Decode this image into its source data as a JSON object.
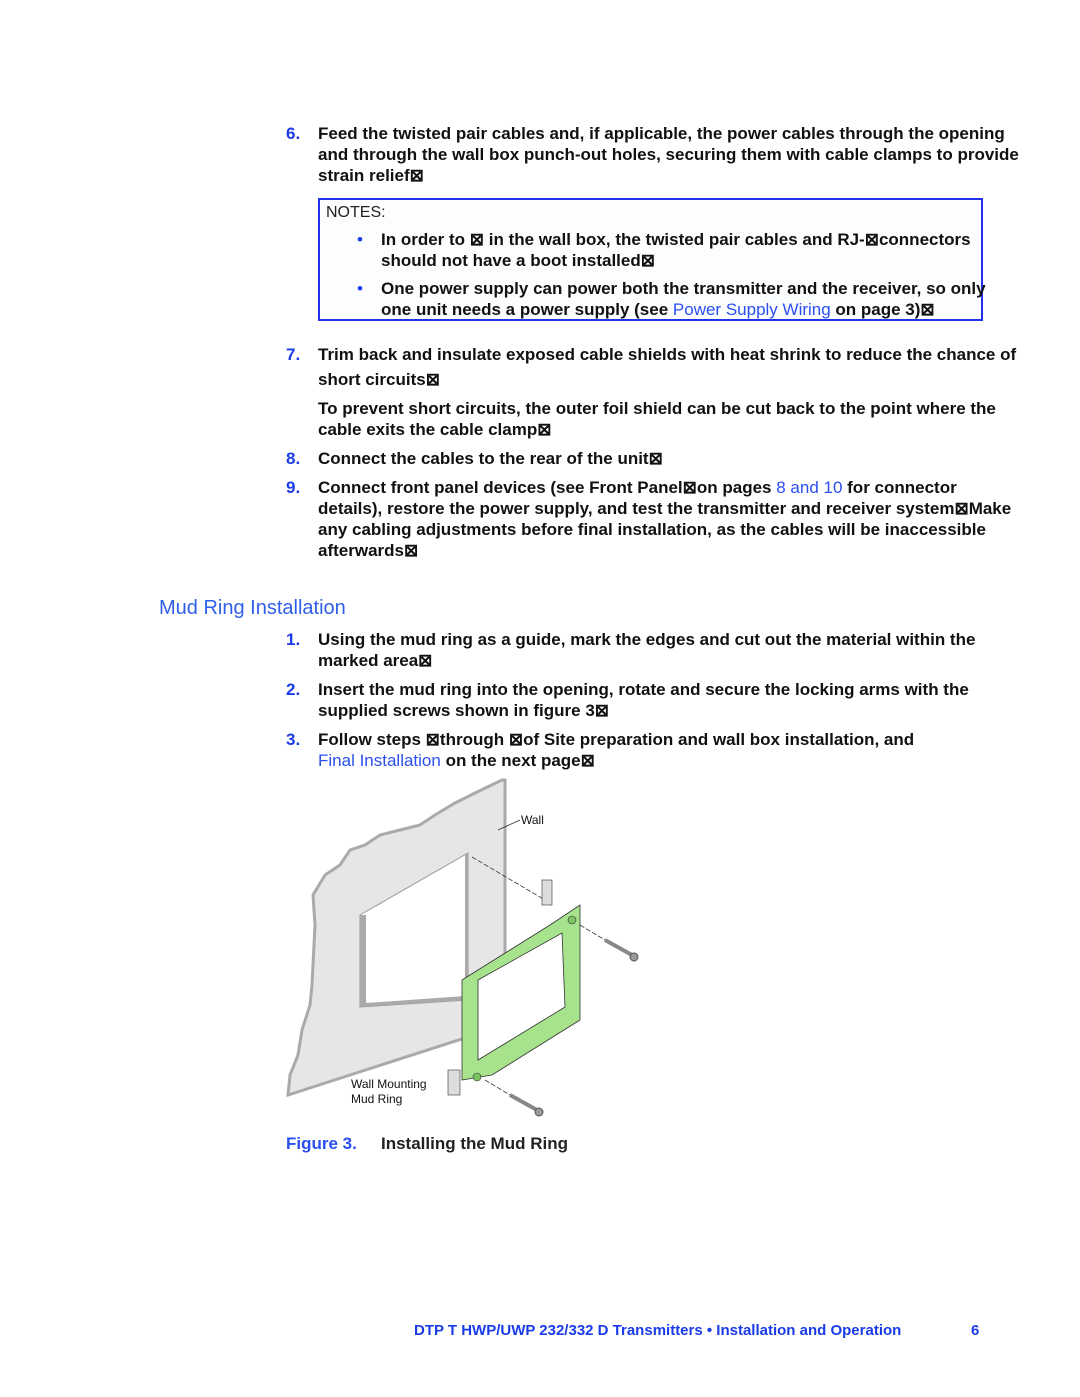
{
  "step6": {
    "num": "6.",
    "lines": [
      "Feed the twisted pair cables and, if applicable, the power cables through the opening",
      "and through the wall box punch-out holes, securing them with cable clamps to provide",
      "strain relief⊠"
    ]
  },
  "notes": {
    "title": "NOTES:",
    "bullet1": [
      "In order to ⊠ in the wall box, the twisted pair cables and RJ-⊠connectors",
      "should not have a boot installed⊠"
    ],
    "bullet2_line1": "One power supply can power both the transmitter and the receiver, so only",
    "bullet2_line2_pre": "one unit needs a power supply (see ",
    "bullet2_link": "Power Supply Wiring",
    "bullet2_line2_post": " on page 3)⊠"
  },
  "step7": {
    "num": "7.",
    "lines": [
      "Trim back and insulate exposed cable shields with heat shrink to reduce the chance of",
      "short circuits⊠"
    ],
    "para": [
      "To prevent short circuits, the outer foil shield can be cut back to the point where the",
      "cable exits the cable clamp⊠"
    ]
  },
  "step8": {
    "num": "8.",
    "text": "Connect the cables to the rear of the unit⊠"
  },
  "step9": {
    "num": "9.",
    "line1_pre": "Connect front panel devices (see Front Panel⊠on pages ",
    "line1_link": "8 and 10",
    "line1_post": " for connector",
    "lines": [
      "details), restore the power supply, and test the transmitter and receiver system⊠Make",
      "any cabling adjustments before final installation, as the cables will be inaccessible",
      "afterwards⊠"
    ]
  },
  "section": {
    "title": "Mud Ring Installation",
    "step1": {
      "num": "1.",
      "lines": [
        "Using the mud ring as a guide, mark the edges and cut out the material within the",
        "marked area⊠"
      ]
    },
    "step2": {
      "num": "2.",
      "lines": [
        "Insert the mud ring into the opening, rotate and secure the locking arms with the",
        "supplied screws shown in figure 3⊠"
      ]
    },
    "step3": {
      "num": "3.",
      "line1": "Follow steps ⊠through ⊠of Site preparation and wall box installation, and",
      "link": "Final Installation",
      "line2_post": " on the next page⊠"
    }
  },
  "figure": {
    "label_wall": "Wall",
    "label_ring_1": "Wall Mounting",
    "label_ring_2": "Mud Ring",
    "caption_num": "Figure 3.",
    "caption": "Installing the Mud Ring",
    "ring_color": "#a6e38c",
    "wall_color": "#e6e6e6"
  },
  "footer": {
    "title": "DTP T HWP/UWP 232/332 D Transmitters • Installation and Operation",
    "page": "6"
  },
  "colors": {
    "accent": "#1a3be8",
    "link": "#2a4ff0",
    "notes_border": "#2233ee"
  }
}
